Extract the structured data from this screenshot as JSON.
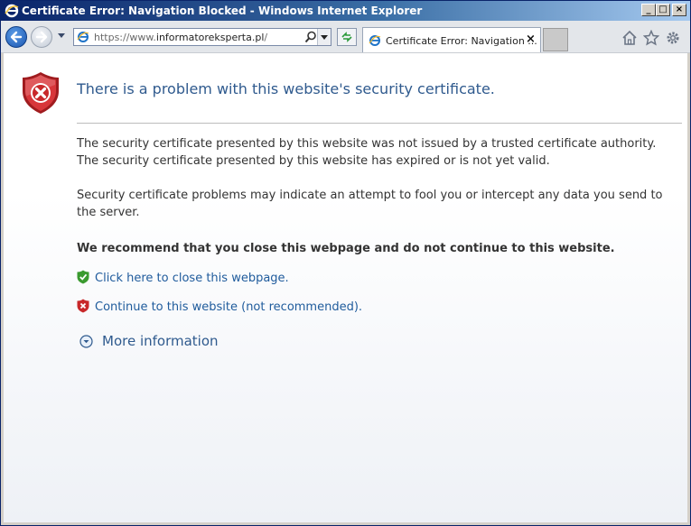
{
  "window": {
    "title": "Certificate Error: Navigation Blocked - Windows Internet Explorer",
    "controls": [
      "_",
      "□",
      "×"
    ]
  },
  "navbar": {
    "address_prefix": "https://www.",
    "address_host": "informatoreksperta.pl",
    "address_suffix": "/",
    "tab_title": "Certificate Error: Navigation ...",
    "tab_close": "×"
  },
  "content": {
    "heading": "There is a problem with this website's security certificate.",
    "line1": "The security certificate presented by this website was not issued by a trusted certificate authority.",
    "line2": "The security certificate presented by this website has expired or is not yet valid.",
    "paragraph2": "Security certificate problems may indicate an attempt to fool you or intercept any data you send to the server.",
    "recommendation": "We recommend that you close this webpage and do not continue to this website.",
    "close_link": "Click here to close this webpage.",
    "continue_link": "Continue to this website (not recommended).",
    "more_info": "More information"
  },
  "icons": {
    "back": "back-arrow-icon",
    "forward": "forward-arrow-icon",
    "home": "home-icon",
    "favorites": "star-icon",
    "tools": "gear-icon",
    "shield_error": "shield-error-icon"
  },
  "colors": {
    "heading": "#2f5a8e",
    "link": "#1f5b9c",
    "shield_red": "#c8282a",
    "shield_green": "#3a9a2f"
  }
}
